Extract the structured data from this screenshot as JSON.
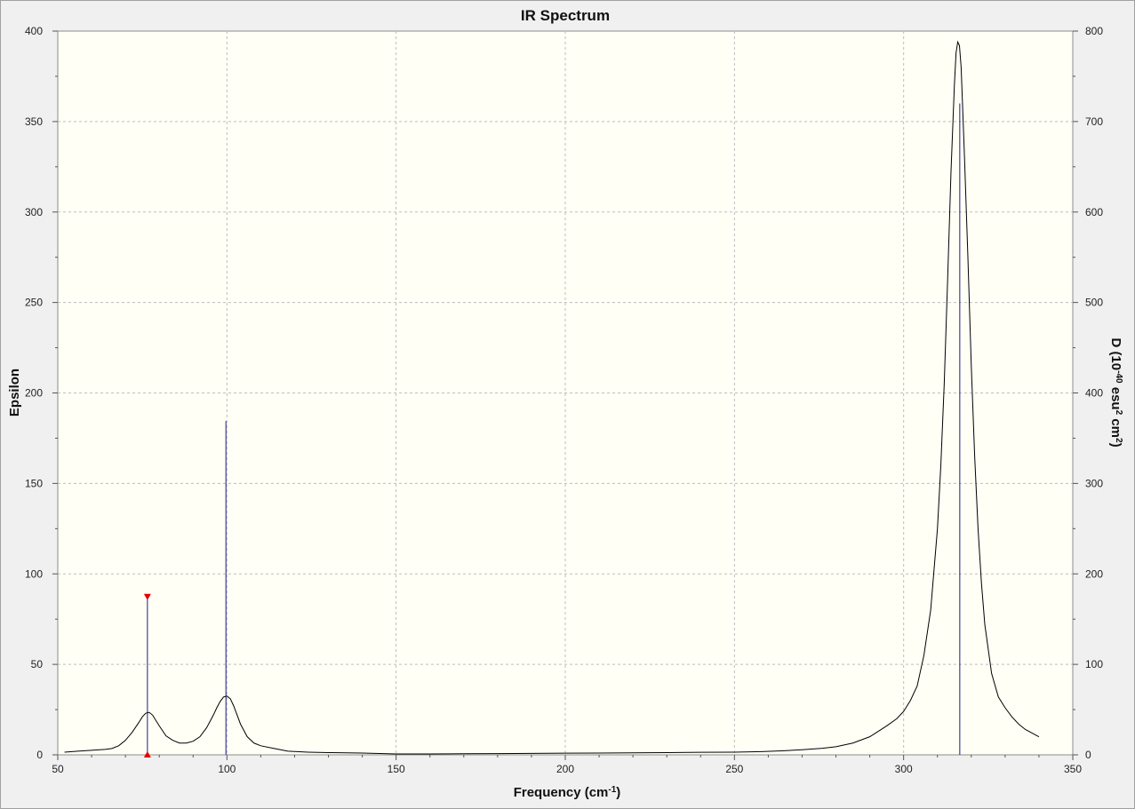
{
  "chart_data": {
    "type": "line",
    "title": "IR Spectrum",
    "xlabel": {
      "base": "Frequency (cm",
      "sup": "-1",
      "tail": ")"
    },
    "ylabel_left": "Epsilon",
    "ylabel_right": {
      "p1": "D (10",
      "s1": "-40",
      "p2": " esu",
      "s2": "2",
      "p3": " cm",
      "s3": "2",
      "p4": ")"
    },
    "xlim": [
      50,
      350
    ],
    "ylim_left": [
      0,
      400
    ],
    "ylim_right": [
      0,
      800
    ],
    "grid": true,
    "x_ticks": [
      "50",
      "100",
      "150",
      "200",
      "250",
      "300",
      "350"
    ],
    "y_left_ticks": [
      "0",
      "50",
      "100",
      "150",
      "200",
      "250",
      "300",
      "350",
      "400"
    ],
    "y_right_ticks": [
      "0",
      "100",
      "200",
      "300",
      "400",
      "500",
      "600",
      "700",
      "800"
    ],
    "spectrum": {
      "x": [
        52,
        56,
        60,
        64,
        66,
        68,
        70,
        72,
        74,
        75,
        76,
        77,
        78,
        80,
        82,
        84,
        86,
        88,
        90,
        92,
        94,
        96,
        97,
        98,
        99,
        100,
        101,
        102,
        104,
        106,
        108,
        110,
        114,
        118,
        124,
        130,
        140,
        150,
        160,
        170,
        180,
        190,
        200,
        210,
        220,
        230,
        240,
        250,
        258,
        264,
        270,
        276,
        280,
        285,
        290,
        295,
        298,
        300,
        302,
        304,
        306,
        308,
        310,
        311,
        312,
        313,
        314,
        315,
        315.5,
        316,
        316.5,
        317,
        318,
        319,
        320,
        321,
        322,
        323,
        324,
        326,
        328,
        330,
        332,
        334,
        336,
        338,
        340
      ],
      "y": [
        1.5,
        2,
        2.5,
        3,
        3.5,
        5,
        8,
        12.5,
        18,
        21,
        23,
        23.5,
        22,
        16,
        10.5,
        8,
        6.5,
        6.5,
        7.5,
        10,
        15,
        22,
        26,
        29.5,
        32,
        32.5,
        31,
        27,
        17,
        10,
        6.5,
        5,
        3.5,
        2,
        1.5,
        1.2,
        1,
        0.5,
        0.5,
        0.6,
        0.7,
        0.8,
        0.9,
        1,
        1.1,
        1.2,
        1.4,
        1.5,
        1.8,
        2.2,
        2.8,
        3.6,
        4.5,
        6.5,
        10,
        16,
        20,
        24,
        30,
        38,
        55,
        80,
        125,
        160,
        205,
        262,
        322,
        370,
        388,
        394,
        392,
        380,
        330,
        275,
        215,
        165,
        125,
        95,
        72,
        45,
        32,
        26,
        21,
        17,
        14,
        12,
        10
      ]
    },
    "vibrations": [
      {
        "freq": 76.5,
        "epsilon": 87.5,
        "selected": true
      },
      {
        "freq": 99.7,
        "epsilon": 184.5,
        "selected": false
      },
      {
        "freq": 316.6,
        "epsilon": 360,
        "selected": false
      }
    ],
    "colors": {
      "plot_bg": "#fffff6",
      "grid": "#bdbdbd",
      "spectrum": "#000000",
      "stick": "#1a1a8c",
      "marker": "#e00000"
    }
  }
}
